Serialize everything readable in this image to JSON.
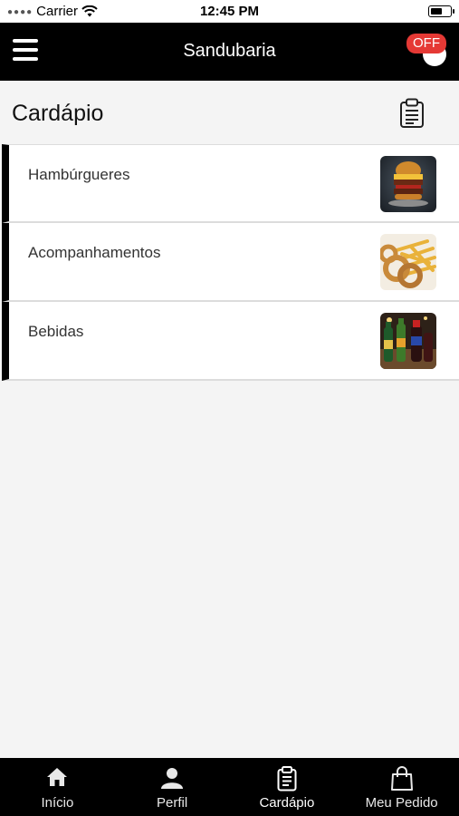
{
  "status_bar": {
    "carrier": "Carrier",
    "time": "12:45 PM"
  },
  "nav": {
    "title": "Sandubaria",
    "off_badge": "OFF"
  },
  "page": {
    "title": "Cardápio"
  },
  "menu": {
    "items": [
      {
        "label": "Hambúrgueres",
        "image": "burger-photo"
      },
      {
        "label": "Acompanhamentos",
        "image": "fries-and-onion-rings-photo"
      },
      {
        "label": "Bebidas",
        "image": "drinks-photo"
      }
    ]
  },
  "tabs": [
    {
      "label": "Início",
      "icon": "home-icon"
    },
    {
      "label": "Perfil",
      "icon": "person-icon"
    },
    {
      "label": "Cardápio",
      "icon": "clipboard-icon",
      "active": true
    },
    {
      "label": "Meu Pedido",
      "icon": "shopping-bag-icon"
    }
  ],
  "colors": {
    "nav_background": "#000000",
    "page_background": "#f4f4f4",
    "badge_red": "#e53935",
    "accent_bar": "#000000"
  }
}
